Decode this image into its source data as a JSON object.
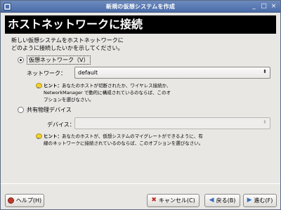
{
  "window": {
    "title": "新規の仮想システムを作成",
    "controls": [
      "_",
      "□",
      "×"
    ]
  },
  "banner": {
    "title": "ホストネットワークに接続"
  },
  "intro": {
    "line1": "新しい仮想システムをホストネットワークに",
    "line2": "どのように接続したいかを示してください。"
  },
  "virtual_network": {
    "radio_label": "仮想ネットワーク（V）",
    "selected": true,
    "field_label": "ネットワーク：",
    "value": "default",
    "hint_title": "ヒント：",
    "hint_line1": "あなたのホストが切断されたか、ワイヤレス接続か、",
    "hint_line2": "NetworkManager で動的に構成されているのならば、このオ",
    "hint_line3": "プションを選びなさい。"
  },
  "shared_device": {
    "radio_label": "共有物理デバイス",
    "selected": false,
    "field_label": "デバイス：",
    "value": "",
    "hint_title": "ヒント：",
    "hint_line1": "あなたのホストが、仮想システムのマイグレートができるように、有",
    "hint_line2": "線のネットワークに接続されているのならば、このオプションを選びなさい。"
  },
  "buttons": {
    "help": "ヘルプ(H)",
    "cancel": "キャンセル(C)",
    "back": "戻る(B)",
    "forward": "進む(F)"
  },
  "icons": {
    "cancel": "✖",
    "back": "◀",
    "forward": "▶",
    "dropdown": "⬍"
  }
}
